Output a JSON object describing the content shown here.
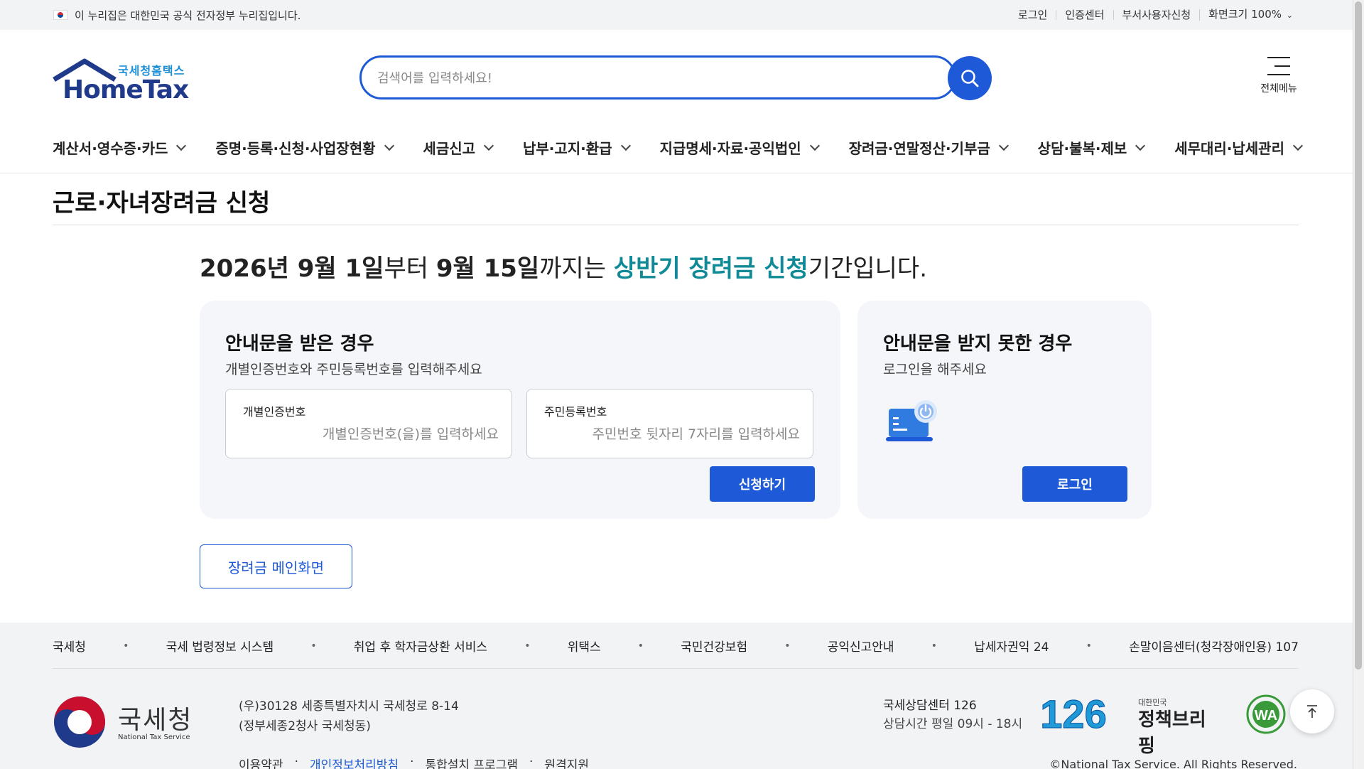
{
  "gov_bar": {
    "text": "이 누리집은 대한민국 공식 전자정부 누리집입니다.",
    "links": [
      "로그인",
      "인증센터",
      "부서사용자신청"
    ],
    "zoom_label": "화면크기 100%"
  },
  "logo": {
    "small": "국세청홈택스",
    "big": "HomeTax"
  },
  "search": {
    "placeholder": "검색어를 입력하세요!"
  },
  "menu_all_label": "전체메뉴",
  "nav": [
    "계산서·영수증·카드",
    "증명·등록·신청·사업장현황",
    "세금신고",
    "납부·고지·환급",
    "지급명세·자료·공익법인",
    "장려금·연말정산·기부금",
    "상담·불복·제보",
    "세무대리·납세관리"
  ],
  "page_title": "근로·자녀장려금 신청",
  "notice": {
    "p1": "2026년 9월 1일",
    "p2": "부터 ",
    "p3": "9월 15일",
    "p4": "까지는 ",
    "p5": "상반기 장려금 신청",
    "p6": "기간입니다."
  },
  "card_a": {
    "title": "안내문을 받은 경우",
    "sub": "개별인증번호와 주민등록번호를 입력해주세요",
    "field1_label": "개별인증번호",
    "field1_placeholder": "개별인증번호(을)를 입력하세요",
    "field2_label": "주민등록번호",
    "field2_placeholder": "주민번호 뒷자리 7자리를 입력하세요",
    "button": "신청하기"
  },
  "card_b": {
    "title": "안내문을 받지 못한 경우",
    "sub": "로그인을 해주세요",
    "button": "로그인"
  },
  "main_button": "장려금 메인화면",
  "footer": {
    "links": [
      "국세청",
      "국세 법령정보 시스템",
      "취업 후 학자금상환 서비스",
      "위택스",
      "국민건강보험",
      "공익신고안내",
      "납세자권익 24",
      "손말이음센터(청각장애인용) 107"
    ],
    "nts_name": "국세청",
    "nts_en": "National Tax Service",
    "address1": "(우)30128 세종특별자치시 국세청로 8-14",
    "address2": "(정부세종2청사 국세청동)",
    "policy": [
      "이용약관",
      "개인정보처리방침",
      "통합설치 프로그램",
      "원격지원"
    ],
    "center_title": "국세상담센터 126",
    "center_hours": "상담시간 평일 09시 - 18시",
    "badge_126": "126",
    "policy_brief_pre": "대한민국",
    "policy_brief_main": "정책브리핑",
    "wa_label": "WA",
    "copyright": "©National Tax Service. All Rights Reserved."
  },
  "colors": {
    "primary": "#1e5ad7",
    "highlight": "#0f8a96",
    "card_bg": "#f4f6fa"
  }
}
